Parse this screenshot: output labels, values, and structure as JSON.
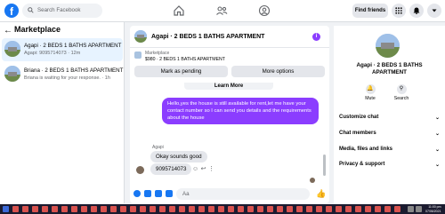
{
  "topbar": {
    "logo": "f",
    "search_placeholder": "Search Facebook",
    "find_friends": "Find friends"
  },
  "sidebar": {
    "back": "←",
    "title": "Marketplace",
    "conversations": [
      {
        "name": "Agapi · 2 BEDS 1 BATHS APARTMENT",
        "sub": "Agapi: 9095714073 · 12m",
        "active": true
      },
      {
        "name": "Briana · 2 BEDS 1 BATHS APARTMENT",
        "sub": "Briana is waiting for your response. · 1h",
        "active": false
      }
    ]
  },
  "chat": {
    "title": "Agapi · 2 BEDS 1 BATHS APARTMENT",
    "info": "i",
    "listing": {
      "label": "Marketplace",
      "price": "$980 · 2 BEDS 1 BATHS APARTMENT",
      "mark_pending": "Mark as pending",
      "more_options": "More options",
      "learn_more": "Learn More"
    },
    "outgoing_message": "Hello,yes the house is still available for rent,let me have your contact number so I can send you details and the requirements about the house",
    "sender_name": "Agapi",
    "incoming_1": "Okay sounds good",
    "incoming_2": "9095714073",
    "composer_placeholder": "Aa",
    "like": "👍"
  },
  "details": {
    "title": "Agapi · 2 BEDS 1 BATHS APARTMENT",
    "mute": "Mute",
    "search": "Search",
    "sections": [
      "Customize chat",
      "Chat members",
      "Media, files and links",
      "Privacy & support"
    ]
  },
  "taskbar": {
    "time": "11:00 pm",
    "date": "07/06/2021"
  }
}
